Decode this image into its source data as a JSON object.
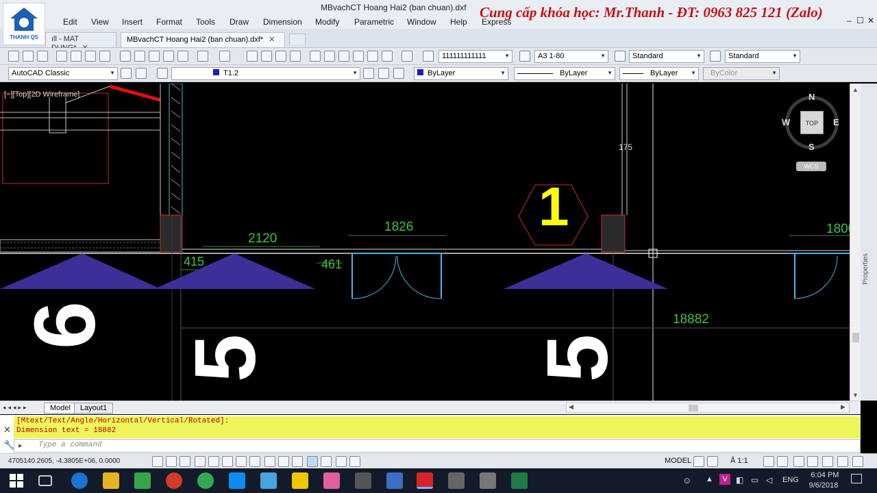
{
  "window": {
    "title": "MBvachCT Hoang Hai2 (ban chuan).dxf",
    "promo_text": "Cung cấp khóa học: Mr.Thanh - ĐT: 0963 825 121 (Zalo)",
    "logo_label": "THANH QS",
    "controls": [
      "–",
      "☐",
      "✕"
    ]
  },
  "menu": [
    "Edit",
    "View",
    "Insert",
    "Format",
    "Tools",
    "Draw",
    "Dimension",
    "Modify",
    "Parametric",
    "Window",
    "Help",
    "Express"
  ],
  "tabs": [
    {
      "label": "ıll - MAT DUNG*",
      "close": "✕"
    },
    {
      "label": "MBvachCT Hoang Hai2 (ban chuan).dxf*",
      "close": "✕"
    }
  ],
  "toolbar1": {
    "text_style": "111111111111",
    "dim_style": "A3 1-80",
    "table_style": "Standard",
    "mleader_style": "Standard"
  },
  "toolbar2": {
    "workspace": "AutoCAD Classic",
    "layer": "T1.2",
    "color": "ByLayer",
    "linetype": "ByLayer",
    "lineweight": "ByLayer",
    "plotstyle": "ByColor"
  },
  "viewport": {
    "label": "[−][Top][2D Wireframe]",
    "compass": {
      "n": "N",
      "s": "S",
      "e": "E",
      "w": "W",
      "top": "TOP",
      "wcs": "WCS"
    },
    "dims": {
      "d2120": "2120",
      "d1826": "1826",
      "d1800": "1800",
      "d415": "415",
      "d461": "461",
      "d175": "175",
      "d18882": "18882"
    },
    "big_numbers": {
      "n1": "1",
      "n6": "6",
      "n5a": "5",
      "n5b": "5"
    },
    "properties_label": "Properties"
  },
  "layout_tabs": [
    "Model",
    "Layout1"
  ],
  "command": {
    "line1": "[Mtext/Text/Angle/Horizontal/Vertical/Rotated]:",
    "line2": "Dimension text = 18882",
    "placeholder": "Type a command"
  },
  "status": {
    "coords": "4705140.2605, -4.3805E+06, 0.0000",
    "model": "MODEL",
    "scale": "1:1"
  },
  "taskbar": {
    "lang": "ENG",
    "time": "6:04 PM",
    "date": "9/6/2018"
  },
  "colors": {
    "accent_red": "#cc1010",
    "cmd_bg": "#eef55a",
    "dim_green": "#3ec43e",
    "triangle": "#3c2f98",
    "door_cyan": "#4fb3e3",
    "yellow": "#ffff00"
  }
}
